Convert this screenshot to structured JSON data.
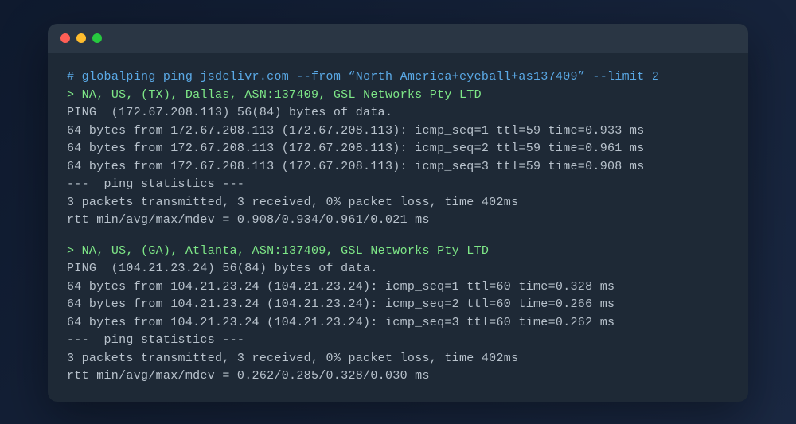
{
  "command": {
    "prompt": "# ",
    "text": "globalping ping jsdelivr.com --from “North America+eyeball+as137409” --limit 2"
  },
  "results": [
    {
      "header_prompt": "> ",
      "header": "NA, US, (TX), Dallas, ASN:137409, GSL Networks Pty LTD",
      "lines": [
        "PING  (172.67.208.113) 56(84) bytes of data.",
        "64 bytes from 172.67.208.113 (172.67.208.113): icmp_seq=1 ttl=59 time=0.933 ms",
        "64 bytes from 172.67.208.113 (172.67.208.113): icmp_seq=2 ttl=59 time=0.961 ms",
        "64 bytes from 172.67.208.113 (172.67.208.113): icmp_seq=3 ttl=59 time=0.908 ms",
        "---  ping statistics ---",
        "3 packets transmitted, 3 received, 0% packet loss, time 402ms",
        "rtt min/avg/max/mdev = 0.908/0.934/0.961/0.021 ms"
      ]
    },
    {
      "header_prompt": "> ",
      "header": "NA, US, (GA), Atlanta, ASN:137409, GSL Networks Pty LTD",
      "lines": [
        "PING  (104.21.23.24) 56(84) bytes of data.",
        "64 bytes from 104.21.23.24 (104.21.23.24): icmp_seq=1 ttl=60 time=0.328 ms",
        "64 bytes from 104.21.23.24 (104.21.23.24): icmp_seq=2 ttl=60 time=0.266 ms",
        "64 bytes from 104.21.23.24 (104.21.23.24): icmp_seq=3 ttl=60 time=0.262 ms",
        "---  ping statistics ---",
        "3 packets transmitted, 3 received, 0% packet loss, time 402ms",
        "rtt min/avg/max/mdev = 0.262/0.285/0.328/0.030 ms"
      ]
    }
  ]
}
